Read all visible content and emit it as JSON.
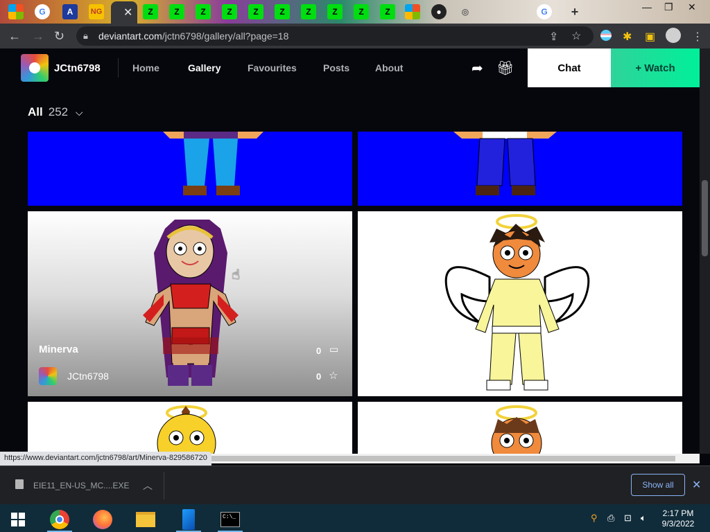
{
  "browser": {
    "url_domain": "deviantart.com",
    "url_path": "/jctn6798/gallery/all?page=18",
    "status_url": "https://www.deviantart.com/jctn6798/art/Minerva-829586720"
  },
  "header": {
    "username": "JCtn6798",
    "nav": [
      "Home",
      "Gallery",
      "Favourites",
      "Posts",
      "About"
    ],
    "active_nav": "Gallery",
    "chat_label": "Chat",
    "watch_label": "+ Watch"
  },
  "filter": {
    "label": "All",
    "count": "252"
  },
  "hovered_card": {
    "title": "Minerva",
    "author": "JCtn6798",
    "comments": "0",
    "favourites": "0"
  },
  "downloads": {
    "file": "EIE11_EN-US_MC....EXE",
    "show_all": "Show all"
  },
  "taskbar": {
    "time": "2:17 PM",
    "date": "9/3/2022"
  },
  "colors": {
    "watch": "#00e59b",
    "card_blue": "#0000ff",
    "page_bg": "#06070d"
  }
}
